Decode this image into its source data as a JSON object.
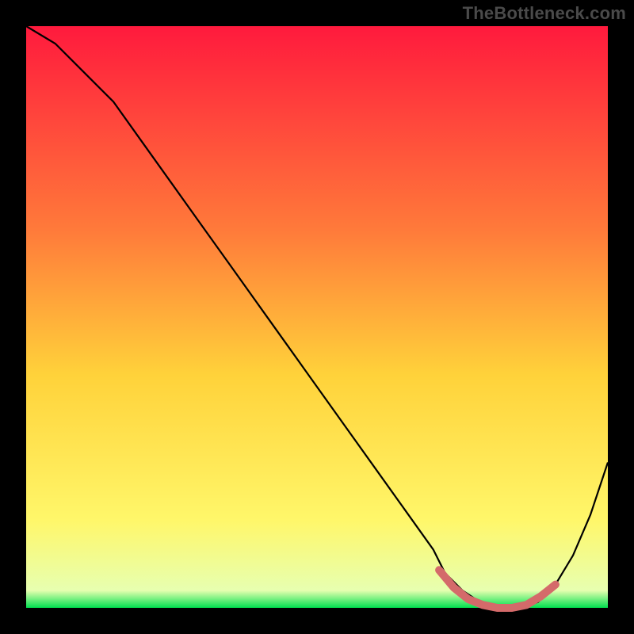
{
  "watermark": "TheBottleneck.com",
  "colors": {
    "frame": "#000000",
    "curve": "#000000",
    "highlight": "#d46a6a",
    "gradient_top": "#ff1a3d",
    "gradient_mid_upper": "#ff7a3a",
    "gradient_mid": "#ffd23a",
    "gradient_mid_lower": "#fff76a",
    "gradient_green": "#00e04f"
  },
  "chart_data": {
    "type": "line",
    "title": "",
    "xlabel": "",
    "ylabel": "",
    "xlim": [
      0,
      100
    ],
    "ylim": [
      0,
      100
    ],
    "x": [
      0,
      5,
      10,
      15,
      20,
      25,
      30,
      35,
      40,
      45,
      50,
      55,
      60,
      65,
      70,
      72,
      75,
      78,
      82,
      85,
      88,
      91,
      94,
      97,
      100
    ],
    "values": [
      100,
      97,
      92,
      87,
      80,
      73,
      66,
      59,
      52,
      45,
      38,
      31,
      24,
      17,
      10,
      6,
      3,
      1,
      0,
      0,
      1,
      4,
      9,
      16,
      25
    ],
    "highlight_x_range": [
      71,
      91
    ],
    "highlight_values": [
      6.5,
      3.5,
      1.5,
      0.5,
      0,
      0,
      0.5,
      2,
      4
    ],
    "annotations": []
  }
}
